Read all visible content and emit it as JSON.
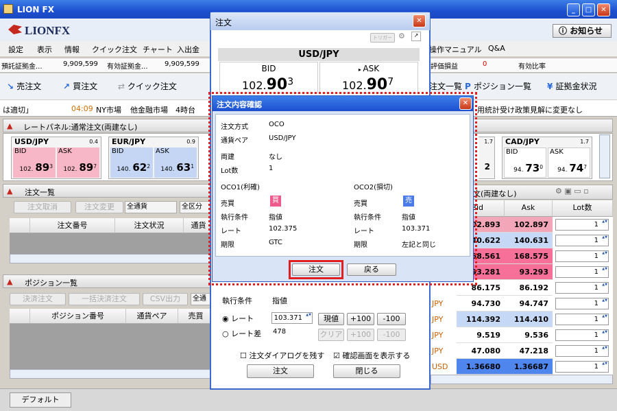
{
  "app": {
    "title": "LION FX",
    "logo": "LIONFX",
    "notice_button": "お知らせ"
  },
  "menu": [
    "設定",
    "表示",
    "情報",
    "クイック注文",
    "チャート",
    "入出金"
  ],
  "menu_right": [
    "操作マニュアル",
    "Q&A"
  ],
  "status_bar": {
    "label1": "預託証拠金...",
    "value1": "9,909,599",
    "label2": "有効証拠金...",
    "value2": "9,909,599",
    "label3": "評価損益",
    "value3": "0",
    "label4": "有効比率"
  },
  "toolbar": {
    "new_order": "売注文",
    "buy_order": "買注文",
    "quick_order": "クイック注文",
    "order_list": "注文一覧",
    "position_list": "ポジション一覧",
    "margin_status": "証拠金状況"
  },
  "ticker": {
    "left": "は適切」",
    "time": "04:09",
    "market": "NY市場",
    "other": "他金融市場",
    "hour": "4時台",
    "right": "用統計受け政策見解に変更なし"
  },
  "rate_panel": {
    "title": "レートパネル:通常注文(両建なし)",
    "pairs": [
      {
        "name": "USD/JPY",
        "spread": "0.4",
        "bid_label": "BID",
        "ask_label": "ASK",
        "bid_small": "102.",
        "bid_big": "89",
        "bid_frac": "3",
        "ask_small": "102.",
        "ask_big": "89",
        "ask_frac": "7"
      },
      {
        "name": "EUR/JPY",
        "spread": "0.9",
        "bid_label": "BID",
        "ask_label": "ASK",
        "bid_small": "140.",
        "bid_big": "62",
        "bid_frac": "2",
        "ask_small": "140.",
        "ask_big": "63",
        "ask_frac": "1"
      },
      {
        "name": "CAD/JPY",
        "spread": "1.7",
        "bid_label": "BID",
        "ask_label": "ASK",
        "bid_small": "94.",
        "bid_big": "73",
        "bid_frac": "0",
        "ask_small": "94.",
        "ask_big": "74",
        "ask_frac": "7"
      }
    ],
    "partial_spread": "1.7",
    "partial_frac": "2"
  },
  "order_list": {
    "title": "注文一覧",
    "cancel": "注文取消",
    "change": "注文変更",
    "filter1": "全通貨",
    "filter2": "全区分",
    "col_check": "",
    "col_number": "注文番号",
    "col_status": "注文状況",
    "col_more": "通貨"
  },
  "position_list": {
    "title": "ポジション一覧",
    "settle": "決済注文",
    "bulk_settle": "一括決済注文",
    "csv": "CSV出力",
    "filter": "全通",
    "col_number": "ポジション番号",
    "col_pair": "通貨ペア",
    "col_side": "売買"
  },
  "footer_tab": "デフォルト",
  "rate_table": {
    "title": "文(両建なし)",
    "col_bid": "Bid",
    "col_ask": "Ask",
    "col_lot": "Lot数",
    "rows": [
      {
        "pair": "",
        "bid": "102.893",
        "ask": "102.897",
        "lot": "1"
      },
      {
        "pair": "",
        "bid": "140.622",
        "ask": "140.631",
        "lot": "1"
      },
      {
        "pair": "",
        "bid": "168.561",
        "ask": "168.575",
        "lot": "1"
      },
      {
        "pair": "",
        "bid": "93.281",
        "ask": "93.293",
        "lot": "1"
      },
      {
        "pair": "",
        "bid": "86.175",
        "ask": "86.192",
        "lot": "1"
      },
      {
        "pair": "JPY",
        "bid": "94.730",
        "ask": "94.747",
        "lot": "1"
      },
      {
        "pair": "JPY",
        "bid": "114.392",
        "ask": "114.410",
        "lot": "1"
      },
      {
        "pair": "JPY",
        "bid": "9.519",
        "ask": "9.536",
        "lot": "1"
      },
      {
        "pair": "JPY",
        "bid": "47.080",
        "ask": "47.218",
        "lot": "1"
      },
      {
        "pair": "USD",
        "bid": "1.36680",
        "ask": "1.36687",
        "lot": "1"
      }
    ]
  },
  "order_window": {
    "title": "注文",
    "trigger": "トリガー",
    "pair": "USD/JPY",
    "bid_label": "BID",
    "ask_label": "ASK",
    "bid_int": "102.",
    "bid_big": "90",
    "bid_frac": "3",
    "ask_int": "102.",
    "ask_big": "90",
    "ask_frac": "7",
    "exec_label": "執行条件",
    "exec_value": "指値",
    "rate_radio": "レート",
    "rate_diff_radio": "レート差",
    "rate_value": "103.371",
    "diff_value": "478",
    "current": "現値",
    "plus": "+100",
    "minus": "-100",
    "clear": "クリア",
    "keep_dialog": "注文ダイアログを残す",
    "show_confirm": "確認画面を表示する",
    "order_btn": "注文",
    "close_btn": "閉じる"
  },
  "confirm": {
    "title": "注文内容確認",
    "method_label": "注文方式",
    "method_value": "OCO",
    "pair_label": "通貨ペア",
    "pair_value": "USD/JPY",
    "hedge_label": "両建",
    "hedge_value": "なし",
    "lot_label": "Lot数",
    "lot_value": "1",
    "oco1_title": "OCO1(利確)",
    "oco2_title": "OCO2(損切)",
    "side_label": "売買",
    "side1": "買",
    "side2": "売",
    "exec_label": "執行条件",
    "exec1": "指値",
    "exec2": "指値",
    "rate_label": "レート",
    "rate1": "102.375",
    "rate2": "103.371",
    "expiry_label": "期限",
    "expiry1": "GTC",
    "expiry2": "左記と同じ",
    "order_btn": "注文",
    "back_btn": "戻る"
  }
}
